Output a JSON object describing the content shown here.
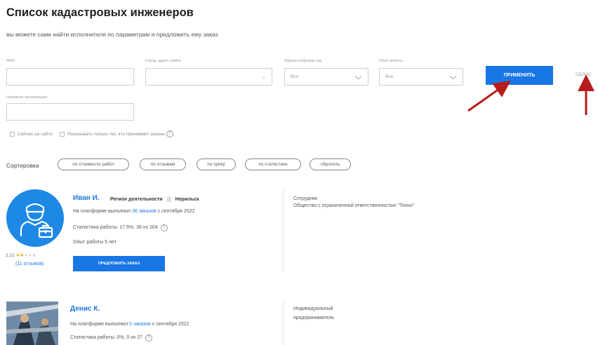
{
  "page": {
    "title": "Список кадастровых инженеров",
    "subtitle": "вы можете сами найти исполнителя по параметрам и предложить ему заказ"
  },
  "filters": {
    "fio_label": "ФИО",
    "fio_value": "",
    "city_label": "Город, адрес, район",
    "city_value": "",
    "city_clear": "×",
    "registered_label": "Зарегистрирован как",
    "registered_value": "Все",
    "experience_label": "Опыт работы",
    "experience_value": "Все",
    "org_label": "Название организации",
    "org_value": "",
    "apply_button": "ПРИМЕНИТЬ",
    "reset_button": "СБРОС",
    "online_checkbox": "Сейчас на сайте",
    "accepting_checkbox": "Показывать только тех, кто принимает заказы",
    "help_mark": "?"
  },
  "sort": {
    "label": "Сортировка",
    "options": [
      "по стоимости работ",
      "по отзывам",
      "по сроку",
      "по статистике",
      "сбросить"
    ]
  },
  "engineers": [
    {
      "name": "Иван И.",
      "region_label": "Регион деятельности",
      "region_value": "Норильск",
      "completed_prefix": "На платформе выполнил",
      "completed_link": "36 заказов",
      "completed_suffix": "с сентября 2022",
      "stats": "Статистика работы: 17.6%, 36 из 204",
      "experience": "Опыт работы 5 лет",
      "rating_value": "2.21",
      "stars_filled": 2,
      "stars_total": 5,
      "reviews": "(11 отзывов)",
      "offer_button": "ПРЕДЛОЖИТЬ ЗАКАЗ",
      "role": "Сотрудник",
      "organization": "Общество с ограниченной ответственностью \"Техно\""
    },
    {
      "name": "Денис К.",
      "completed_prefix": "На платформе выполнил",
      "completed_link": "0 заказов",
      "completed_suffix": "с сентября 2022",
      "stats": "Статистика работы: 0%, 0 из 27",
      "role_line1": "Индивидуальный",
      "role_line2": "предприниматель"
    }
  ],
  "colors": {
    "accent": "#1976e5",
    "arrow": "#b71c1c",
    "star": "#e6a700"
  }
}
